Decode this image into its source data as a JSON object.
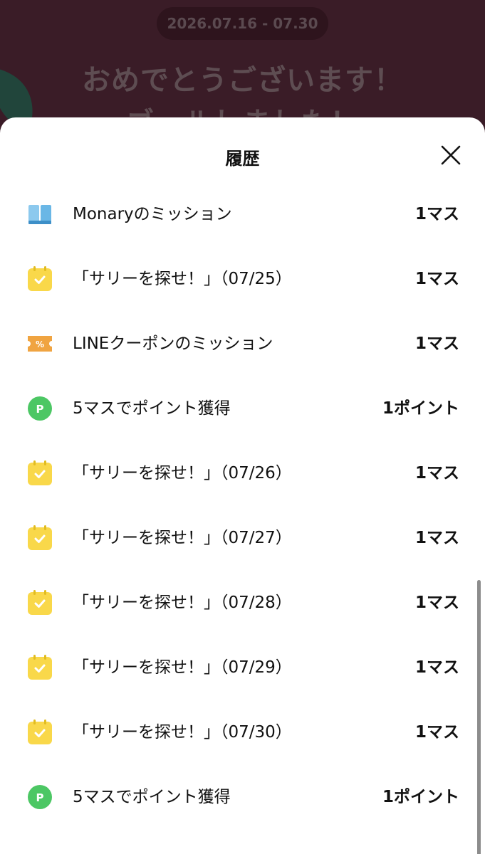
{
  "background": {
    "date_range": "2026.07.16 - 07.30",
    "congrats_line1": "おめでとうございます！",
    "congrats_line2": "ゴールしました！"
  },
  "sheet": {
    "title": "履歴",
    "close_icon": "close-icon"
  },
  "history": [
    {
      "icon": "book-icon",
      "label": "Monaryのミッション",
      "amount": "1マス"
    },
    {
      "icon": "calendar-check-icon",
      "label": "「サリーを探せ！」（07/25）",
      "amount": "1マス"
    },
    {
      "icon": "coupon-icon",
      "label": "LINEクーポンのミッション",
      "amount": "1マス"
    },
    {
      "icon": "point-icon",
      "label": "5マスでポイント獲得",
      "amount": "1ポイント"
    },
    {
      "icon": "calendar-check-icon",
      "label": "「サリーを探せ！」（07/26）",
      "amount": "1マス"
    },
    {
      "icon": "calendar-check-icon",
      "label": "「サリーを探せ！」（07/27）",
      "amount": "1マス"
    },
    {
      "icon": "calendar-check-icon",
      "label": "「サリーを探せ！」（07/28）",
      "amount": "1マス"
    },
    {
      "icon": "calendar-check-icon",
      "label": "「サリーを探せ！」（07/29）",
      "amount": "1マス"
    },
    {
      "icon": "calendar-check-icon",
      "label": "「サリーを探せ！」（07/30）",
      "amount": "1マス"
    },
    {
      "icon": "point-icon",
      "label": "5マスでポイント獲得",
      "amount": "1ポイント"
    }
  ],
  "colors": {
    "background": "#3a1c27",
    "calendar_yellow": "#f9d84a",
    "coupon_orange": "#f0a441",
    "point_green": "#4cc764",
    "book_blue": "#6ab7e6"
  }
}
